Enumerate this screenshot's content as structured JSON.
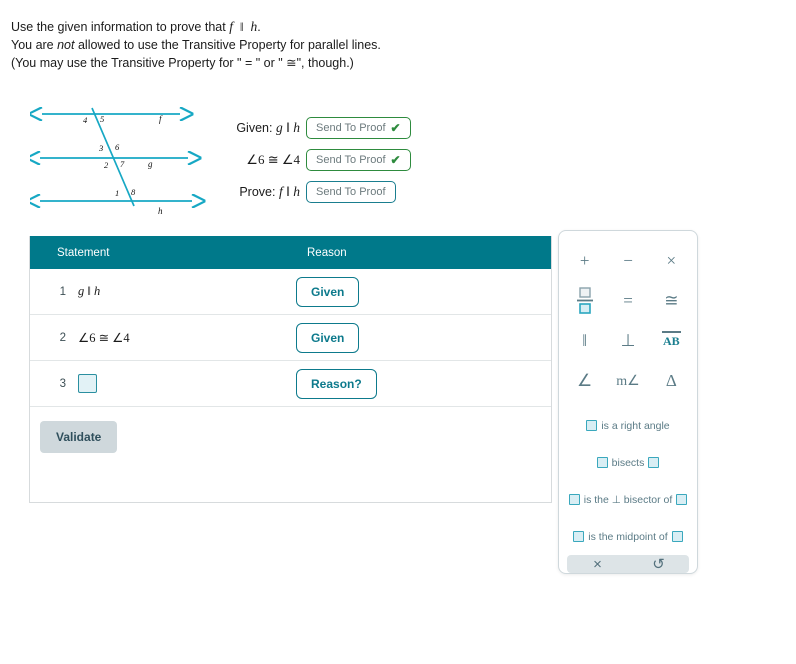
{
  "instructions": {
    "line1_pre": "Use the given information to prove that",
    "line1_f": "f",
    "line1_par": "‖",
    "line1_h": "h",
    "line1_post": ".",
    "line2_pre": "You are ",
    "line2_em": "not",
    "line2_post": " allowed to use the Transitive Property for parallel lines.",
    "line3": "(You may use the Transitive Property for \" = \" or \" ≅\", though.)"
  },
  "diagram": {
    "line_f_label": "f",
    "line_g_label": "g",
    "line_h_label": "h",
    "angles": [
      "1",
      "2",
      "3",
      "4",
      "5",
      "6",
      "7",
      "8"
    ],
    "line_color": "#17a8c4"
  },
  "given_prove": {
    "rows": [
      {
        "label": "Given:",
        "statement": "g ‖ h",
        "button": "Send To Proof",
        "state": "done"
      },
      {
        "label": "",
        "statement": "∠6 ≅ ∠4",
        "button": "Send To Proof",
        "state": "done"
      },
      {
        "label": "Prove:",
        "statement": "f ‖ h",
        "button": "Send To Proof",
        "state": "todo"
      }
    ],
    "check_glyph": "✔"
  },
  "proof": {
    "header": {
      "statement": "Statement",
      "reason": "Reason"
    },
    "rows": [
      {
        "num": "1",
        "statement": "g ‖ h",
        "reason": "Given",
        "blank": false
      },
      {
        "num": "2",
        "statement": "∠6 ≅ ∠4",
        "reason": "Given",
        "blank": false
      },
      {
        "num": "3",
        "statement": "",
        "reason": "Reason?",
        "blank": true
      }
    ],
    "validate_label": "Validate"
  },
  "palette": {
    "symbols": [
      {
        "name": "plus-icon",
        "glyph": "+"
      },
      {
        "name": "minus-icon",
        "glyph": "−"
      },
      {
        "name": "times-icon",
        "glyph": "×"
      },
      {
        "name": "fraction-icon",
        "glyph": ""
      },
      {
        "name": "equals-icon",
        "glyph": "="
      },
      {
        "name": "congruent-icon",
        "glyph": "≅"
      },
      {
        "name": "parallel-icon",
        "glyph": "‖"
      },
      {
        "name": "perpendicular-icon",
        "glyph": "⊥"
      },
      {
        "name": "segment-ab-icon",
        "glyph": "AB"
      },
      {
        "name": "angle-icon",
        "glyph": "∠"
      },
      {
        "name": "measure-angle-icon",
        "glyph": "m∠"
      },
      {
        "name": "triangle-icon",
        "glyph": "Δ"
      }
    ],
    "phrases": [
      {
        "name": "is-a-right-angle",
        "parts": [
          "box",
          " is a right angle"
        ]
      },
      {
        "name": "bisects",
        "parts": [
          "box",
          " bisects ",
          "box"
        ]
      },
      {
        "name": "is-perp-bisector-of",
        "parts": [
          "box",
          " is the ⊥ bisector of ",
          "box"
        ]
      },
      {
        "name": "is-the-midpoint-of",
        "parts": [
          "box",
          " is the midpoint of ",
          "box"
        ]
      }
    ],
    "footer": {
      "delete_glyph": "×",
      "undo_glyph": "↺"
    }
  },
  "colors": {
    "header_teal": "#00798a",
    "accent_teal": "#0d7a8c",
    "green": "#2e8b3e",
    "diagram_cyan": "#17a8c4"
  }
}
